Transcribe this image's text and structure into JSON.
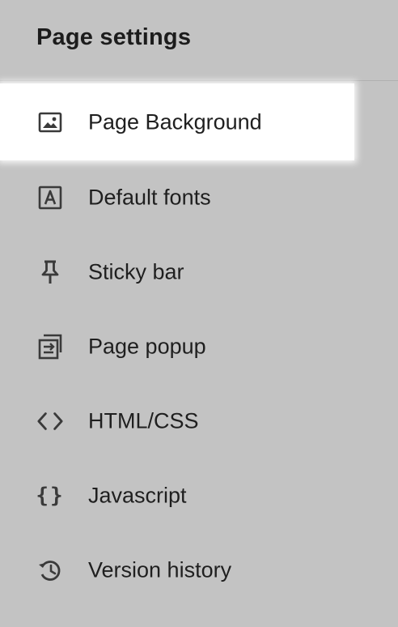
{
  "header": {
    "title": "Page settings"
  },
  "menu": {
    "items": [
      {
        "label": "Page Background",
        "icon": "image-icon",
        "active": true
      },
      {
        "label": "Default fonts",
        "icon": "font-icon",
        "active": false
      },
      {
        "label": "Sticky bar",
        "icon": "pin-icon",
        "active": false
      },
      {
        "label": "Page popup",
        "icon": "popup-icon",
        "active": false
      },
      {
        "label": "HTML/CSS",
        "icon": "code-icon",
        "active": false
      },
      {
        "label": "Javascript",
        "icon": "braces-icon",
        "active": false
      },
      {
        "label": "Version history",
        "icon": "history-icon",
        "active": false
      }
    ]
  },
  "colors": {
    "panel_bg": "#c3c3c3",
    "active_bg": "#ffffff",
    "text": "#1f1f1f",
    "icon": "#3a3a3a"
  }
}
